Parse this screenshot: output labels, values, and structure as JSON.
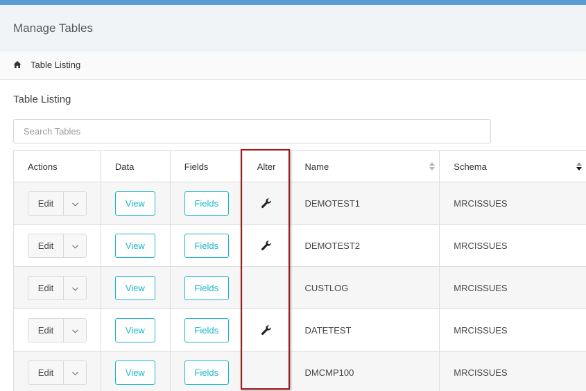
{
  "header": {
    "title": "Manage Tables"
  },
  "breadcrumb": {
    "home_icon": "home-icon",
    "current": "Table Listing"
  },
  "section": {
    "title": "Table Listing"
  },
  "search": {
    "placeholder": "Search Tables",
    "value": ""
  },
  "table": {
    "columns": {
      "actions": "Actions",
      "data": "Data",
      "fields": "Fields",
      "alter": "Alter",
      "name": "Name",
      "schema": "Schema"
    },
    "sort": {
      "column": "Schema",
      "direction": "descending"
    },
    "edit_label": "Edit",
    "view_label": "View",
    "fields_label": "Fields",
    "rows": [
      {
        "name": "DEMOTEST1",
        "schema": "MRCISSUES",
        "alter": true
      },
      {
        "name": "DEMOTEST2",
        "schema": "MRCISSUES",
        "alter": true
      },
      {
        "name": "CUSTLOG",
        "schema": "MRCISSUES",
        "alter": false
      },
      {
        "name": "DATETEST",
        "schema": "MRCISSUES",
        "alter": true
      },
      {
        "name": "DMCMP100",
        "schema": "MRCISSUES",
        "alter": false
      }
    ]
  },
  "colors": {
    "accent": "#19b6c9",
    "topbar": "#5b9bd5",
    "highlight": "#a31818"
  }
}
